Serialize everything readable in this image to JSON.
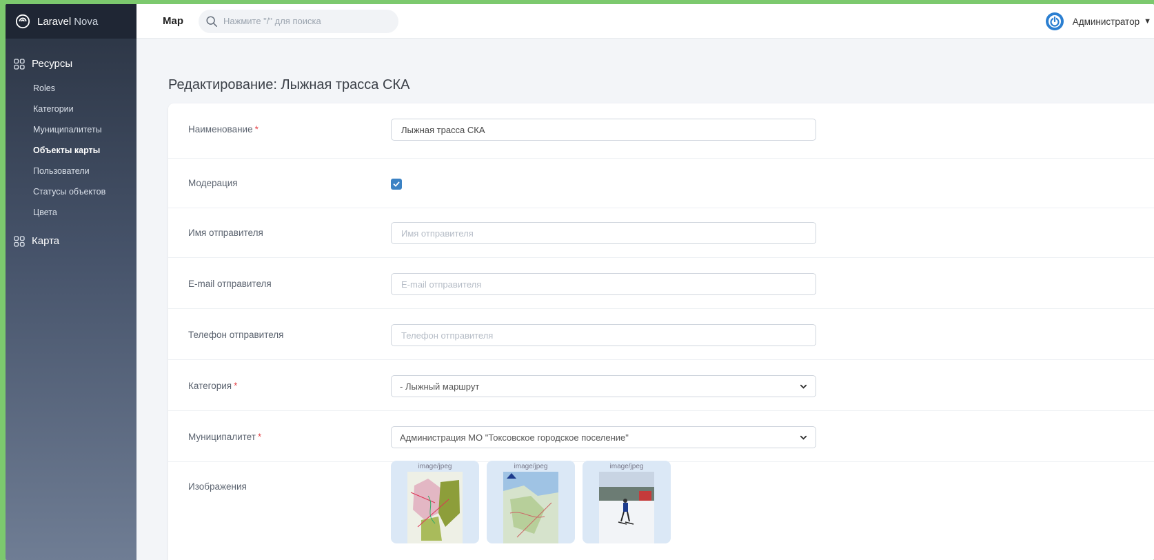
{
  "brand": {
    "name": "Laravel",
    "suffix": "Nova"
  },
  "topbar": {
    "title": "Map",
    "search_placeholder": "Нажмите \"/\" для поиска",
    "user_name": "Администратор"
  },
  "sidebar": {
    "resources_label": "Ресурсы",
    "items": [
      {
        "label": "Roles"
      },
      {
        "label": "Категории"
      },
      {
        "label": "Муниципалитеты"
      },
      {
        "label": "Объекты карты"
      },
      {
        "label": "Пользователи"
      },
      {
        "label": "Статусы объектов"
      },
      {
        "label": "Цвета"
      }
    ],
    "map_label": "Карта"
  },
  "page": {
    "title": "Редактирование: Лыжная трасса СКА"
  },
  "form": {
    "name": {
      "label": "Наименование",
      "required": "*",
      "value": "Лыжная трасса СКА"
    },
    "moderation": {
      "label": "Модерация",
      "checked": true
    },
    "sender_name": {
      "label": "Имя отправителя",
      "placeholder": "Имя отправителя"
    },
    "sender_email": {
      "label": "E-mail отправителя",
      "placeholder": "E-mail отправителя"
    },
    "sender_phone": {
      "label": "Телефон отправителя",
      "placeholder": "Телефон отправителя"
    },
    "category": {
      "label": "Категория",
      "required": "*",
      "value": "- Лыжный маршрут"
    },
    "municipality": {
      "label": "Муниципалитет",
      "required": "*",
      "value": "Администрация МО \"Токсовское городское поселение\""
    },
    "images": {
      "label": "Изображения",
      "items": [
        {
          "mime": "image/jpeg"
        },
        {
          "mime": "image/jpeg"
        },
        {
          "mime": "image/jpeg"
        }
      ]
    }
  },
  "colors": {
    "accent": "#3b82c4",
    "sidebar_dark": "#1f2634",
    "required": "#e5484d"
  }
}
